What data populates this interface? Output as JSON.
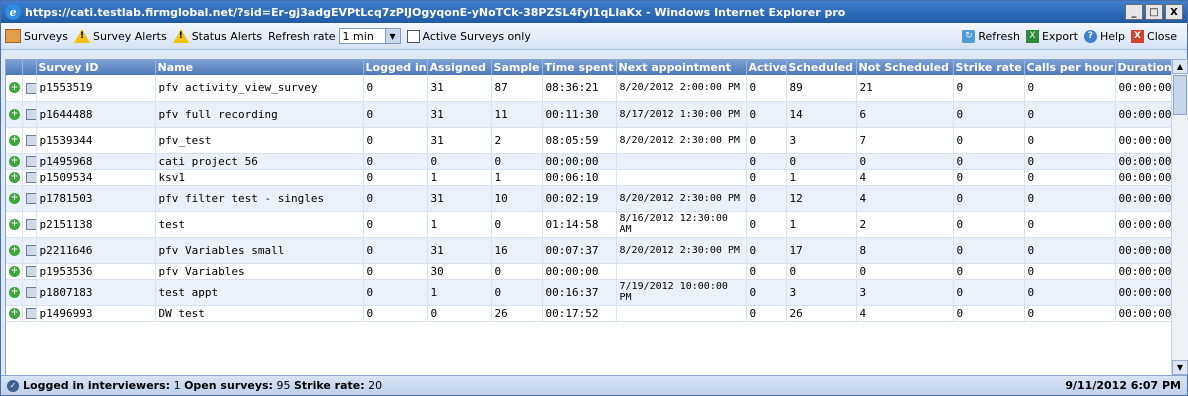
{
  "window": {
    "title": "https://cati.testlab.firmglobal.net/?sid=Er-gj3adgEVPtLcq7zPIJOgyqonE-yNoTCk-38PZSL4fyl1qLlaKx - Windows Internet Explorer pro",
    "min": "_",
    "max": "□",
    "close": "X"
  },
  "toolbar": {
    "surveys": "Surveys",
    "survey_alerts": "Survey Alerts",
    "status_alerts": "Status Alerts",
    "refresh_rate_label": "Refresh rate",
    "refresh_rate_value": "1 min",
    "active_surveys_only": "Active Surveys only",
    "refresh": "Refresh",
    "export": "Export",
    "help": "Help",
    "close": "Close"
  },
  "columns": {
    "survey_id": "Survey ID",
    "name": "Name",
    "logged_in": "Logged in",
    "assigned": "Assigned",
    "sample": "Sample",
    "time_spent": "Time spent",
    "next_appointment": "Next appointment",
    "active": "Active",
    "scheduled": "Scheduled",
    "not_scheduled": "Not Scheduled",
    "strike_rate": "Strike rate",
    "calls_per_hour": "Calls per hour",
    "duration": "Duration"
  },
  "rows": [
    {
      "id": "p1553519",
      "name": "pfv activity_view_survey",
      "logged": "0",
      "assigned": "31",
      "sample": "87",
      "time": "08:36:21",
      "appt": "8/20/2012 2:00:00 PM",
      "active": "0",
      "scheduled": "89",
      "not_scheduled": "21",
      "strike": "0",
      "calls": "0",
      "duration": "00:00:00"
    },
    {
      "id": "p1644488",
      "name": "pfv full recording",
      "logged": "0",
      "assigned": "31",
      "sample": "11",
      "time": "00:11:30",
      "appt": "8/17/2012 1:30:00 PM",
      "active": "0",
      "scheduled": "14",
      "not_scheduled": "6",
      "strike": "0",
      "calls": "0",
      "duration": "00:00:00"
    },
    {
      "id": "p1539344",
      "name": "pfv_test",
      "logged": "0",
      "assigned": "31",
      "sample": "2",
      "time": "08:05:59",
      "appt": "8/20/2012 2:30:00 PM",
      "active": "0",
      "scheduled": "3",
      "not_scheduled": "7",
      "strike": "0",
      "calls": "0",
      "duration": "00:00:00"
    },
    {
      "id": "p1495968",
      "name": "cati project 56",
      "logged": "0",
      "assigned": "0",
      "sample": "0",
      "time": "00:00:00",
      "appt": "",
      "active": "0",
      "scheduled": "0",
      "not_scheduled": "0",
      "strike": "0",
      "calls": "0",
      "duration": "00:00:00"
    },
    {
      "id": "p1509534",
      "name": "ksv1",
      "logged": "0",
      "assigned": "1",
      "sample": "1",
      "time": "00:06:10",
      "appt": "",
      "active": "0",
      "scheduled": "1",
      "not_scheduled": "4",
      "strike": "0",
      "calls": "0",
      "duration": "00:00:00"
    },
    {
      "id": "p1781503",
      "name": "pfv filter test - singles",
      "logged": "0",
      "assigned": "31",
      "sample": "10",
      "time": "00:02:19",
      "appt": "8/20/2012 2:30:00 PM",
      "active": "0",
      "scheduled": "12",
      "not_scheduled": "4",
      "strike": "0",
      "calls": "0",
      "duration": "00:00:00"
    },
    {
      "id": "p2151138",
      "name": "test",
      "logged": "0",
      "assigned": "1",
      "sample": "0",
      "time": "01:14:58",
      "appt": "8/16/2012 12:30:00 AM",
      "active": "0",
      "scheduled": "1",
      "not_scheduled": "2",
      "strike": "0",
      "calls": "0",
      "duration": "00:00:00"
    },
    {
      "id": "p2211646",
      "name": "pfv Variables small",
      "logged": "0",
      "assigned": "31",
      "sample": "16",
      "time": "00:07:37",
      "appt": "8/20/2012 2:30:00 PM",
      "active": "0",
      "scheduled": "17",
      "not_scheduled": "8",
      "strike": "0",
      "calls": "0",
      "duration": "00:00:00"
    },
    {
      "id": "p1953536",
      "name": "pfv Variables",
      "logged": "0",
      "assigned": "30",
      "sample": "0",
      "time": "00:00:00",
      "appt": "",
      "active": "0",
      "scheduled": "0",
      "not_scheduled": "0",
      "strike": "0",
      "calls": "0",
      "duration": "00:00:00"
    },
    {
      "id": "p1807183",
      "name": "test appt",
      "logged": "0",
      "assigned": "1",
      "sample": "0",
      "time": "00:16:37",
      "appt": "7/19/2012 10:00:00 PM",
      "active": "0",
      "scheduled": "3",
      "not_scheduled": "3",
      "strike": "0",
      "calls": "0",
      "duration": "00:00:00"
    },
    {
      "id": "p1496993",
      "name": "DW test",
      "logged": "0",
      "assigned": "0",
      "sample": "26",
      "time": "00:17:52",
      "appt": "",
      "active": "0",
      "scheduled": "26",
      "not_scheduled": "4",
      "strike": "0",
      "calls": "0",
      "duration": "00:00:00"
    }
  ],
  "status": {
    "logged_label": "Logged in interviewers:",
    "logged_value": "1",
    "open_label": "Open surveys:",
    "open_value": "95",
    "strike_label": "Strike rate:",
    "strike_value": "20",
    "date": "9/11/2012 6:07 PM"
  }
}
